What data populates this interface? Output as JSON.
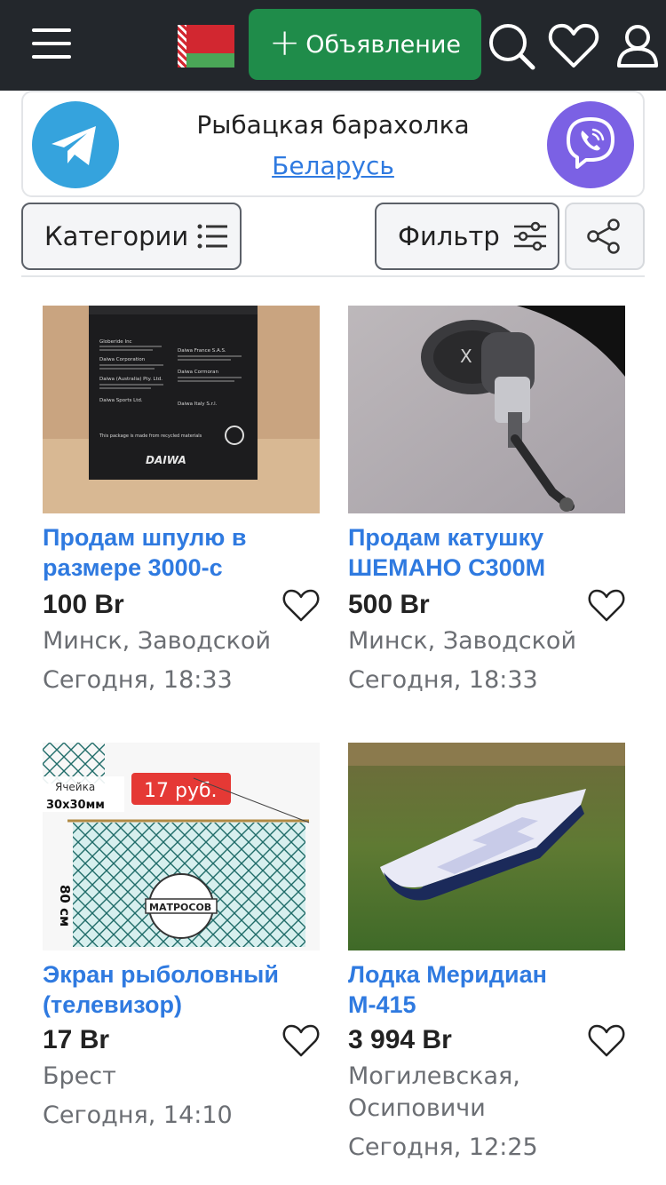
{
  "header": {
    "post_label": "Объявление",
    "post_plus": "+"
  },
  "banner": {
    "title": "Рыбацкая барахолка",
    "link": "Беларусь"
  },
  "controls": {
    "categories_label": "Категории",
    "filter_label": "Фильтр"
  },
  "listings": [
    {
      "title_line1": "Продам шпулю в",
      "title_line2": "размере 3000-с",
      "price": "100 Br",
      "loc_line1": "Минск, Заводской",
      "loc_line2": "",
      "time": "Сегодня, 18:33",
      "photo": {
        "box_lines": [
          "Globeride Inc",
          "Daiwa Corporation",
          "Daiwa (Australia) Pty. Ltd.",
          "Daiwa Sports Ltd.",
          "Daiwa France S.A.S.",
          "Daiwa Cormoran",
          "Daiwa Italy S.r.l."
        ],
        "recycle_text": "This package is made from recycled materials",
        "brand": "DAIWA"
      }
    },
    {
      "title_line1": "Продам катушку",
      "title_line2": "ШЕМАНО С300М",
      "price": "500 Br",
      "loc_line1": "Минск, Заводской",
      "loc_line2": "",
      "time": "Сегодня, 18:33",
      "photo": {
        "reel_text": "X"
      }
    },
    {
      "title_line1": "Экран рыболовный",
      "title_line2": "(телевизор)",
      "price": "17 Br",
      "loc_line1": "Брест",
      "loc_line2": "",
      "time": "Сегодня, 14:10",
      "photo": {
        "cell_label": "Ячейка",
        "cell_size": "30x30мм",
        "price_tag": "17 руб.",
        "height_label": "80 см",
        "logo": "МАТРОСОВ"
      }
    },
    {
      "title_line1": "Лодка Меридиан",
      "title_line2": "М-415",
      "price": "3 994 Br",
      "loc_line1": "Могилевская,",
      "loc_line2": "Осиповичи",
      "time": "Сегодня, 12:25",
      "photo": {}
    }
  ],
  "icons": {
    "menu": "hamburger-icon",
    "flag": "belarus-flag-icon",
    "search": "search-icon",
    "favorites": "heart-icon",
    "profile": "user-icon",
    "telegram": "telegram-icon",
    "viber": "viber-icon",
    "categories": "list-icon",
    "filter": "sliders-icon",
    "share": "share-icon"
  },
  "colors": {
    "topbar": "#23272c",
    "accent_green": "#1f8c4a",
    "link_blue": "#2f7ae0",
    "telegram": "#35a3dd",
    "viber": "#7b61e4"
  }
}
